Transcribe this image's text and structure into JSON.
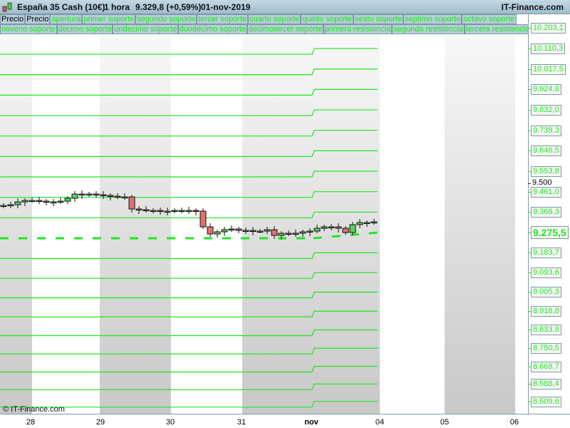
{
  "header": {
    "title": "España 35 Cash (10€)",
    "timeframe": "1 hora",
    "price": "9.329,8 (+0,59%)",
    "date": "01-nov-2019",
    "site": "IT-Finance.com"
  },
  "legend_row1": [
    "Precio",
    "Precio",
    "apertura",
    "primer soporte",
    "segundo soporte",
    "tercer soporte",
    "cuarto soporte",
    "quinto soporte",
    "sexto soporte",
    "septimo soporte",
    "octavo soporte"
  ],
  "legend_row2": [
    "noveno soporte",
    "decimo soporte",
    "undecimo soporte",
    "duodecimo soporte",
    "decimotercer soporte",
    "primera resistencia",
    "segunda resistencia",
    "tercera resistencia"
  ],
  "copyright": "© IT-Finance.com",
  "colors": {
    "level": "#1ee81e",
    "up": "#5ccf5c",
    "down": "#e07070"
  },
  "chart_data": {
    "type": "candlestick",
    "x_labels": [
      "28",
      "29",
      "30",
      "31",
      "nov",
      "04",
      "05",
      "06"
    ],
    "y_plain_label": "9.500",
    "current_value_label": "9.275,5",
    "levels_new": [
      10203.1,
      10110.3,
      10017.5,
      9924.8,
      9832.0,
      9739.3,
      9646.5,
      9553.8,
      9461.0,
      9368.3,
      9275.5,
      9183.7,
      9093.6,
      9005.3,
      8918.8,
      8833.8,
      8750.5,
      8668.7,
      8588.4,
      8509.6
    ],
    "levels_labels": [
      "10.203,1",
      "10.110,3",
      "10.017,5",
      "9.924,8",
      "9.832,0",
      "9.739,3",
      "9.646,5",
      "9.553,8",
      "9.461,0",
      "9.368,3",
      "9.275,5",
      "9.183,7",
      "9.093,6",
      "9.005,3",
      "8.918,8",
      "8.833,8",
      "8.750,5",
      "8.668,7",
      "8.588,4",
      "8.509,6"
    ],
    "closes": [
      9398.5,
      9401.7,
      9414.6,
      9421.1,
      9421.1,
      9417.9,
      9414.6,
      9414.6,
      9417.9,
      9430.8,
      9450.2,
      9447,
      9450.2,
      9447,
      9443.8,
      9440.5,
      9437.3,
      9437.3,
      9382.3,
      9379.1,
      9375.8,
      9375.8,
      9372.6,
      9372.6,
      9375.8,
      9375.8,
      9375.8,
      9372.6,
      9301.4,
      9269,
      9278.7,
      9288.4,
      9291.7,
      9285.2,
      9285.2,
      9282,
      9282,
      9288.4,
      9262.6,
      9272.3,
      9269,
      9272.3,
      9278.7,
      9282,
      9294.9,
      9301.4,
      9301.4,
      9294.9,
      9275.5,
      9311.1,
      9320.8,
      9320.8,
      9324
    ]
  }
}
